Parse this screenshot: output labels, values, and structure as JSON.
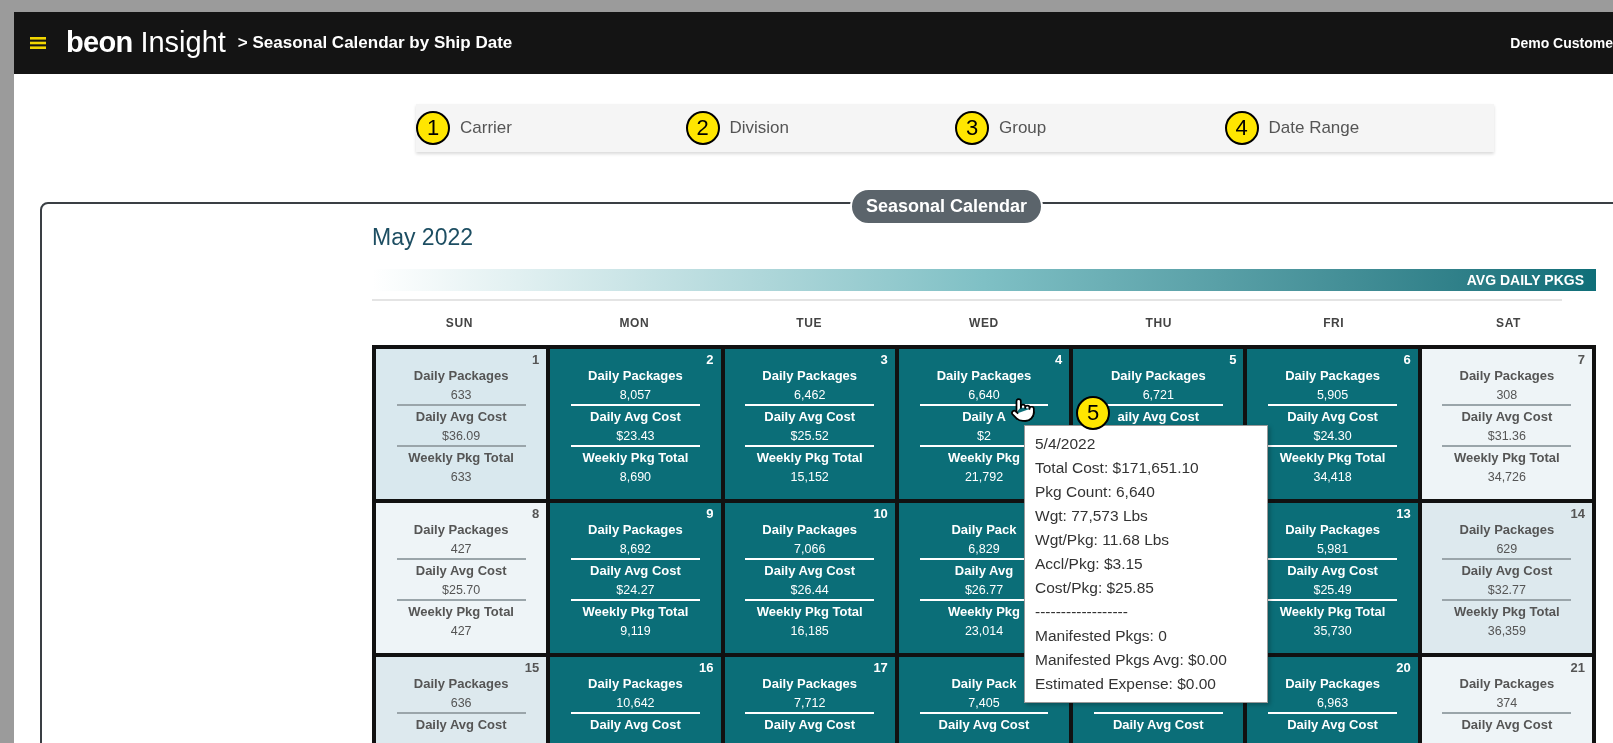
{
  "header": {
    "brand_bold": "beon",
    "brand_light": "Insight",
    "breadcrumb": "> Seasonal Calendar by Ship Date",
    "user": "Demo Custome"
  },
  "filters": [
    {
      "badge": "1",
      "label": "Carrier"
    },
    {
      "badge": "2",
      "label": "Division"
    },
    {
      "badge": "3",
      "label": "Group"
    },
    {
      "badge": "4",
      "label": "Date Range"
    }
  ],
  "panel": {
    "title": "Seasonal Calendar",
    "month": "May 2022",
    "legend": "AVG DAILY PKGS",
    "weekdays": [
      "SUN",
      "MON",
      "TUE",
      "WED",
      "THU",
      "FRI",
      "SAT"
    ],
    "weeks": [
      [
        {
          "day": "1",
          "color": "#d9e8ee",
          "metrics": [
            {
              "label": "Daily Packages",
              "value": "633"
            },
            {
              "label": "Daily Avg Cost",
              "value": "$36.09"
            },
            {
              "label": "Weekly Pkg Total",
              "value": "633"
            }
          ]
        },
        {
          "day": "2",
          "color": "#0b6e78",
          "metrics": [
            {
              "label": "Daily Packages",
              "value": "8,057"
            },
            {
              "label": "Daily Avg Cost",
              "value": "$23.43"
            },
            {
              "label": "Weekly Pkg Total",
              "value": "8,690"
            }
          ]
        },
        {
          "day": "3",
          "color": "#0b6e78",
          "metrics": [
            {
              "label": "Daily Packages",
              "value": "6,462"
            },
            {
              "label": "Daily Avg Cost",
              "value": "$25.52"
            },
            {
              "label": "Weekly Pkg Total",
              "value": "15,152"
            }
          ]
        },
        {
          "day": "4",
          "color": "#0b6e78",
          "metrics": [
            {
              "label": "Daily Packages",
              "value": "6,640"
            },
            {
              "label": "Daily A",
              "value": "$2"
            },
            {
              "label": "Weekly Pkg",
              "value": "21,792"
            }
          ]
        },
        {
          "day": "5",
          "color": "#0b6e78",
          "metrics": [
            {
              "label": "Daily Packages",
              "value": "6,721"
            },
            {
              "label": "aily Avg Cost"
            }
          ]
        },
        {
          "day": "6",
          "color": "#0b6e78",
          "metrics": [
            {
              "label": "Daily Packages",
              "value": "5,905"
            },
            {
              "label": "Daily Avg Cost",
              "value": "$24.30"
            },
            {
              "label": "Weekly Pkg Total",
              "value": "34,418"
            }
          ]
        },
        {
          "day": "7",
          "color": "#eef4f7",
          "metrics": [
            {
              "label": "Daily Packages",
              "value": "308"
            },
            {
              "label": "Daily Avg Cost",
              "value": "$31.36"
            },
            {
              "label": "Weekly Pkg Total",
              "value": "34,726"
            }
          ]
        }
      ],
      [
        {
          "day": "8",
          "color": "#eef4f7",
          "metrics": [
            {
              "label": "Daily Packages",
              "value": "427"
            },
            {
              "label": "Daily Avg Cost",
              "value": "$25.70"
            },
            {
              "label": "Weekly Pkg Total",
              "value": "427"
            }
          ]
        },
        {
          "day": "9",
          "color": "#0b6e78",
          "metrics": [
            {
              "label": "Daily Packages",
              "value": "8,692"
            },
            {
              "label": "Daily Avg Cost",
              "value": "$24.27"
            },
            {
              "label": "Weekly Pkg Total",
              "value": "9,119"
            }
          ]
        },
        {
          "day": "10",
          "color": "#0b6e78",
          "metrics": [
            {
              "label": "Daily Packages",
              "value": "7,066"
            },
            {
              "label": "Daily Avg Cost",
              "value": "$26.44"
            },
            {
              "label": "Weekly Pkg Total",
              "value": "16,185"
            }
          ]
        },
        {
          "color": "#0b6e78",
          "metrics": [
            {
              "label": "Daily Pack",
              "value": "6,829"
            },
            {
              "label": "Daily Avg",
              "value": "$26.77"
            },
            {
              "label": "Weekly Pkg",
              "value": "23,014"
            }
          ]
        },
        {
          "kind": "covered"
        },
        {
          "day": "13",
          "color": "#0b6e78",
          "metrics": [
            {
              "label": "Daily Packages",
              "value": "5,981"
            },
            {
              "label": "Daily Avg Cost",
              "value": "$25.49"
            },
            {
              "label": "Weekly Pkg Total",
              "value": "35,730"
            }
          ]
        },
        {
          "day": "14",
          "color": "#dde9ee",
          "metrics": [
            {
              "label": "Daily Packages",
              "value": "629"
            },
            {
              "label": "Daily Avg Cost",
              "value": "$32.77"
            },
            {
              "label": "Weekly Pkg Total",
              "value": "36,359"
            }
          ]
        }
      ],
      [
        {
          "day": "15",
          "color": "#dde9ee",
          "metrics": [
            {
              "label": "Daily Packages",
              "value": "636"
            },
            {
              "label": "Daily Avg Cost"
            }
          ]
        },
        {
          "day": "16",
          "color": "#0b6e78",
          "metrics": [
            {
              "label": "Daily Packages",
              "value": "10,642"
            },
            {
              "label": "Daily Avg Cost"
            }
          ]
        },
        {
          "day": "17",
          "color": "#0b6e78",
          "metrics": [
            {
              "label": "Daily Packages",
              "value": "7,712"
            },
            {
              "label": "Daily Avg Cost"
            }
          ]
        },
        {
          "color": "#0b6e78",
          "metrics": [
            {
              "label": "Daily Pack",
              "value": "7,405"
            },
            {
              "label": "Daily Avg Cost"
            }
          ]
        },
        {
          "kind": "top-covered",
          "color": "#0b6e78",
          "metrics": [
            {
              "label": "Daily Avg Cost"
            }
          ]
        },
        {
          "day": "20",
          "color": "#0b6e78",
          "metrics": [
            {
              "label": "Daily Packages",
              "value": "6,963"
            },
            {
              "label": "Daily Avg Cost"
            }
          ]
        },
        {
          "day": "21",
          "color": "#eef4f7",
          "metrics": [
            {
              "label": "Daily Packages",
              "value": "374"
            },
            {
              "label": "Daily Avg Cost"
            }
          ]
        }
      ]
    ],
    "tooltip": {
      "badge": "5",
      "lines": [
        "5/4/2022",
        "Total Cost: $171,651.10",
        "Pkg Count: 6,640",
        "Wgt: 77,573 Lbs",
        "Wgt/Pkg: 11.68 Lbs",
        "Accl/Pkg: $3.15",
        "Cost/Pkg: $25.85",
        "------------------",
        "Manifested Pkgs: 0",
        "Manifested Pkgs Avg: $0.00",
        "Estimated Expense: $0.00"
      ]
    }
  }
}
